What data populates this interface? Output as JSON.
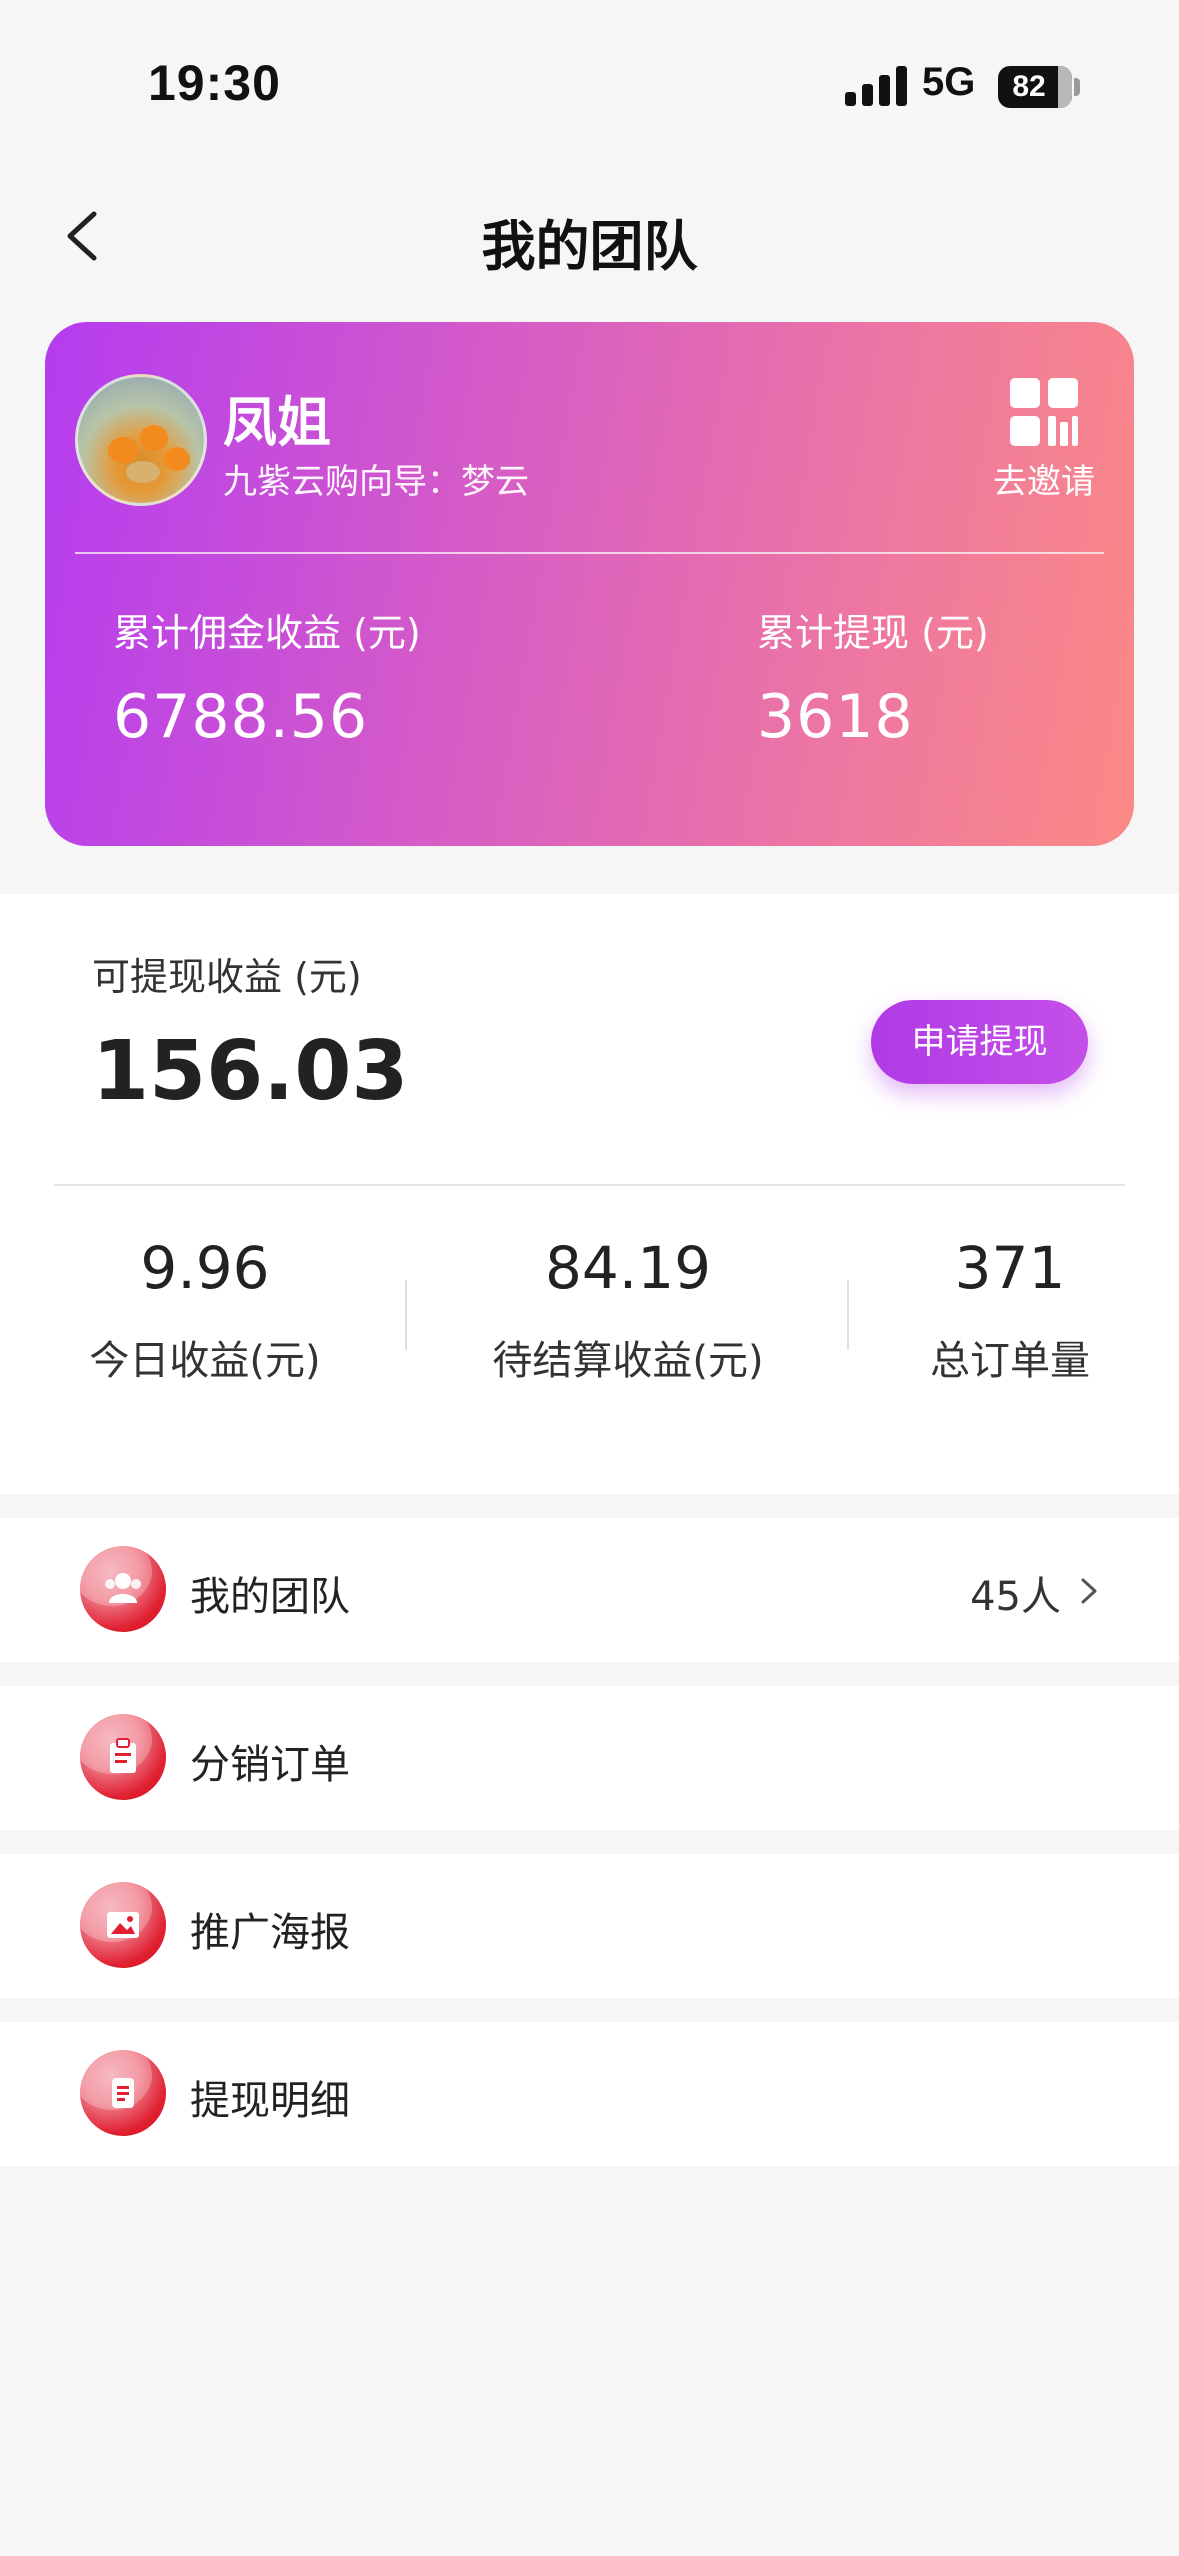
{
  "status": {
    "time": "19:30",
    "network": "5G",
    "battery": "82"
  },
  "nav": {
    "title": "我的团队"
  },
  "profile": {
    "name": "凤姐",
    "guide": "九紫云购向导：梦云",
    "invite_label": "去邀请",
    "commission_label": "累计佣金收益 (元)",
    "commission_value": "6788.56",
    "withdrawn_label": "累计提现 (元)",
    "withdrawn_value": "3618"
  },
  "earnings": {
    "available_label": "可提现收益 (元)",
    "available_value": "156.03",
    "withdraw_button": "申请提现",
    "stats": [
      {
        "value": "9.96",
        "label": "今日收益(元)"
      },
      {
        "value": "84.19",
        "label": "待结算收益(元)"
      },
      {
        "value": "371",
        "label": "总订单量"
      }
    ]
  },
  "menu": [
    {
      "label": "我的团队",
      "count": "45人",
      "icon": "team-icon"
    },
    {
      "label": "分销订单",
      "icon": "order-icon"
    },
    {
      "label": "推广海报",
      "icon": "poster-icon"
    },
    {
      "label": "提现明细",
      "icon": "withdraw-detail-icon"
    }
  ],
  "colors": {
    "gradient_start": "#b43cf0",
    "gradient_end": "#fb8a85",
    "icon_red": "#e02030",
    "button_purple": "#b03ae6"
  }
}
